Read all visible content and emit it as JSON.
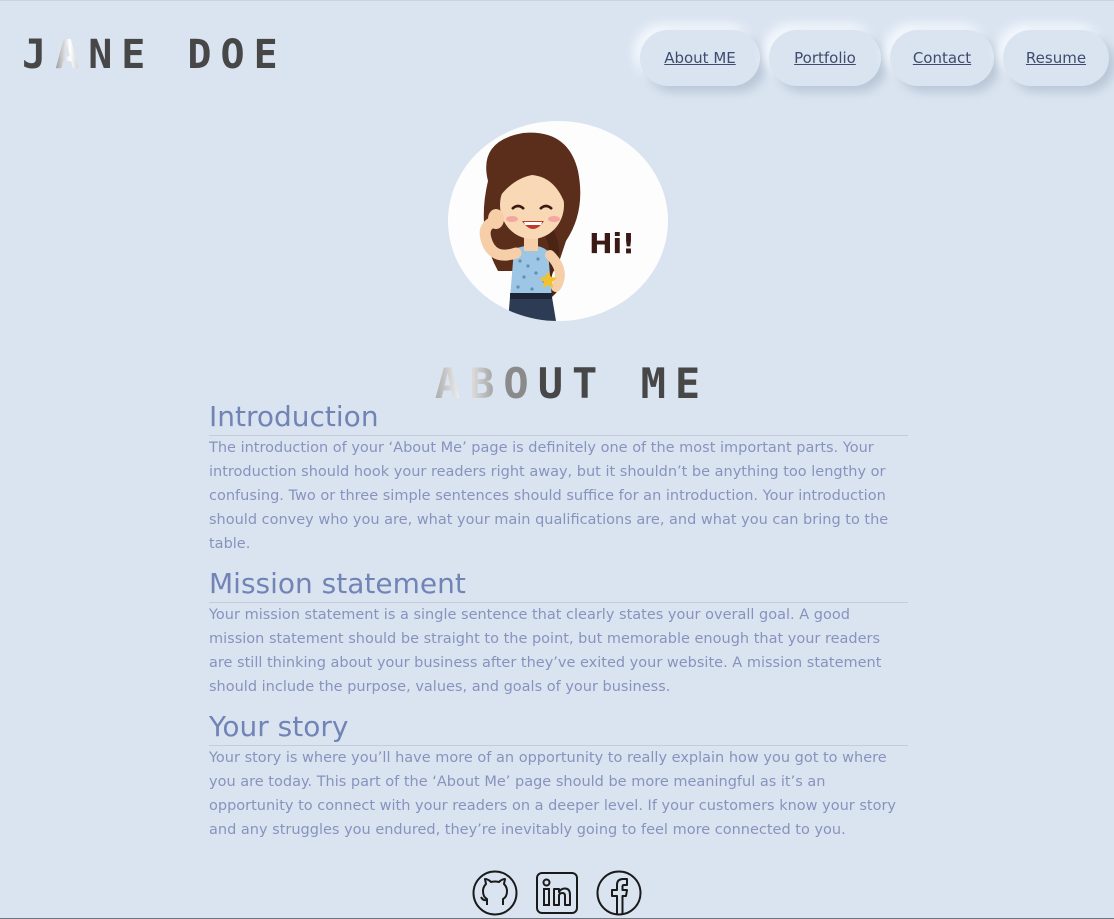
{
  "header": {
    "logo_first": "J",
    "logo_shine": "A",
    "logo_rest": "NE DOE"
  },
  "nav": {
    "items": [
      {
        "label": "About ME"
      },
      {
        "label": "Portfolio"
      },
      {
        "label": "Contact"
      },
      {
        "label": "Resume"
      }
    ]
  },
  "avatar": {
    "greeting": "Hi!"
  },
  "page_title": {
    "part_shine": "AB",
    "part_mid": "O",
    "part_rest": "UT ME"
  },
  "sections": [
    {
      "heading": "Introduction",
      "body": "The introduction of your ‘About Me’ page is definitely one of the most important parts. Your introduction should hook your readers right away, but it shouldn’t be anything too lengthy or confusing. Two or three simple sentences should suffice for an introduction. Your introduction should convey who you are, what your main qualifications are, and what you can bring to the table."
    },
    {
      "heading": "Mission statement",
      "body": "Your mission statement is a single sentence that clearly states your overall goal. A good mission statement should be straight to the point, but memorable enough that your readers are still thinking about your business after they’ve exited your website. A mission statement should include the purpose, values, and goals of your business."
    },
    {
      "heading": "Your story",
      "body": "Your story is where you’ll have more of an opportunity to really explain how you got to where you are today. This part of the ‘About Me’ page should be more meaningful as it’s an opportunity to connect with your readers on a deeper level. If your customers know your story and any struggles you endured, they’re inevitably going to feel more connected to you."
    }
  ],
  "social": {
    "icons": [
      "github-icon",
      "linkedin-icon",
      "facebook-icon"
    ]
  },
  "colors": {
    "background": "#dae4f1",
    "heading": "#7284b5",
    "body_text": "#8793bd",
    "nav_text": "#3f4b6e",
    "logo": "#474747"
  }
}
